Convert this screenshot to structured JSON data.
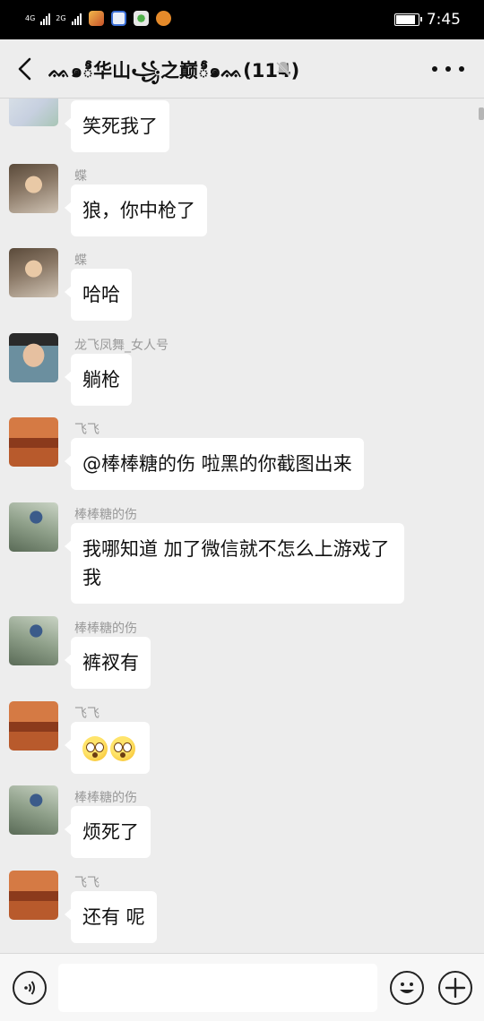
{
  "status_bar": {
    "network_1": "4G",
    "network_2": "2G",
    "time": "7:45",
    "battery_level": 0.92
  },
  "header": {
    "title": "ᨐ๑ీ华山꧁之巅ీ๑ᨐ(114)",
    "muted": true
  },
  "messages": [
    {
      "sender": "",
      "text": "笑死我了",
      "avatar": "top-avatar"
    },
    {
      "sender": "蝶",
      "text": "狼，你中枪了",
      "avatar": "baby-avatar"
    },
    {
      "sender": "蝶",
      "text": "哈哈",
      "avatar": "baby-avatar"
    },
    {
      "sender": "龙飞凤舞_女人号",
      "text": "躺枪",
      "avatar": "man-avatar"
    },
    {
      "sender": "飞飞",
      "text": "@棒棒糖的伤  啦黑的你截图出来",
      "avatar": "poster-avatar"
    },
    {
      "sender": "棒棒糖的伤",
      "text": "我哪知道 加了微信就不怎么上游戏了我",
      "avatar": "girl-avatar"
    },
    {
      "sender": "棒棒糖的伤",
      "text": "裤衩有",
      "avatar": "girl-avatar"
    },
    {
      "sender": "飞飞",
      "text": "",
      "emoji": [
        "shocked-emoji",
        "shocked-emoji"
      ],
      "avatar": "poster-avatar"
    },
    {
      "sender": "棒棒糖的伤",
      "text": "烦死了",
      "avatar": "girl-avatar"
    },
    {
      "sender": "飞飞",
      "text": "还有 呢",
      "avatar": "poster-avatar"
    }
  ],
  "input": {
    "value": "",
    "placeholder": ""
  },
  "colors": {
    "background": "#ededed",
    "bubble": "#ffffff",
    "sender": "#999999"
  }
}
